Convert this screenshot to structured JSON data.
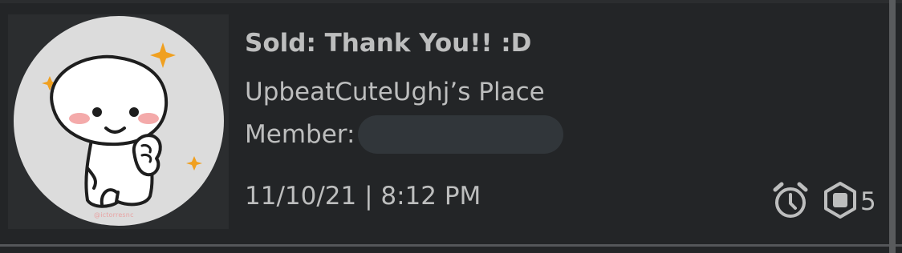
{
  "transaction": {
    "title": "Sold: Thank You!! :D",
    "place": "UpbeatCuteUghj’s Place",
    "member_label": "Member:",
    "member_value": "",
    "timestamp": "11/10/21 | 8:12 PM",
    "robux_amount": "5",
    "thumbnail_watermark": "@ictorresnc"
  },
  "icons": {
    "pending": "alarm-clock-icon",
    "currency": "robux-icon"
  },
  "colors": {
    "background": "#232527",
    "text": "#bdbebe",
    "sparkle": "#f0a020",
    "cheek": "#f4aaaa",
    "redaction": "#31363a"
  }
}
